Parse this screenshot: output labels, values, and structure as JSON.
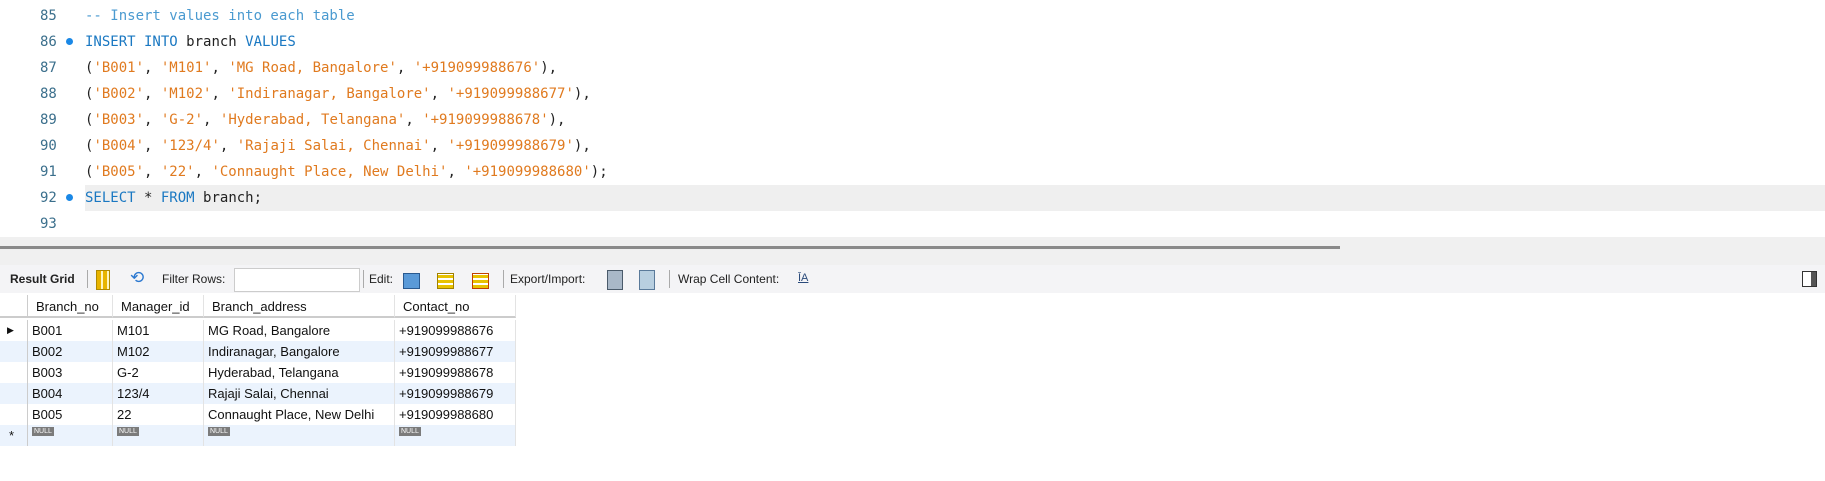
{
  "editor": {
    "lines": [
      {
        "num": "85",
        "marker": false,
        "tokens": [
          {
            "t": "cm",
            "v": "-- Insert values into each table"
          }
        ]
      },
      {
        "num": "86",
        "marker": true,
        "tokens": [
          {
            "t": "kw",
            "v": "INSERT INTO "
          },
          {
            "t": "id",
            "v": "branch "
          },
          {
            "t": "kw",
            "v": "VALUES"
          }
        ]
      },
      {
        "num": "87",
        "marker": false,
        "tokens": [
          {
            "t": "id",
            "v": "("
          },
          {
            "t": "str",
            "v": "'B001'"
          },
          {
            "t": "id",
            "v": ", "
          },
          {
            "t": "str",
            "v": "'M101'"
          },
          {
            "t": "id",
            "v": ", "
          },
          {
            "t": "str",
            "v": "'MG Road, Bangalore'"
          },
          {
            "t": "id",
            "v": ", "
          },
          {
            "t": "str",
            "v": "'+919099988676'"
          },
          {
            "t": "id",
            "v": "),"
          }
        ]
      },
      {
        "num": "88",
        "marker": false,
        "tokens": [
          {
            "t": "id",
            "v": "("
          },
          {
            "t": "str",
            "v": "'B002'"
          },
          {
            "t": "id",
            "v": ", "
          },
          {
            "t": "str",
            "v": "'M102'"
          },
          {
            "t": "id",
            "v": ", "
          },
          {
            "t": "str",
            "v": "'Indiranagar, Bangalore'"
          },
          {
            "t": "id",
            "v": ", "
          },
          {
            "t": "str",
            "v": "'+919099988677'"
          },
          {
            "t": "id",
            "v": "),"
          }
        ]
      },
      {
        "num": "89",
        "marker": false,
        "tokens": [
          {
            "t": "id",
            "v": "("
          },
          {
            "t": "str",
            "v": "'B003'"
          },
          {
            "t": "id",
            "v": ", "
          },
          {
            "t": "str",
            "v": "'G-2'"
          },
          {
            "t": "id",
            "v": ", "
          },
          {
            "t": "str",
            "v": "'Hyderabad, Telangana'"
          },
          {
            "t": "id",
            "v": ", "
          },
          {
            "t": "str",
            "v": "'+919099988678'"
          },
          {
            "t": "id",
            "v": "),"
          }
        ]
      },
      {
        "num": "90",
        "marker": false,
        "tokens": [
          {
            "t": "id",
            "v": "("
          },
          {
            "t": "str",
            "v": "'B004'"
          },
          {
            "t": "id",
            "v": ", "
          },
          {
            "t": "str",
            "v": "'123/4'"
          },
          {
            "t": "id",
            "v": ", "
          },
          {
            "t": "str",
            "v": "'Rajaji Salai, Chennai'"
          },
          {
            "t": "id",
            "v": ", "
          },
          {
            "t": "str",
            "v": "'+919099988679'"
          },
          {
            "t": "id",
            "v": "),"
          }
        ]
      },
      {
        "num": "91",
        "marker": false,
        "tokens": [
          {
            "t": "id",
            "v": "("
          },
          {
            "t": "str",
            "v": "'B005'"
          },
          {
            "t": "id",
            "v": ", "
          },
          {
            "t": "str",
            "v": "'22'"
          },
          {
            "t": "id",
            "v": ", "
          },
          {
            "t": "str",
            "v": "'Connaught Place, New Delhi'"
          },
          {
            "t": "id",
            "v": ", "
          },
          {
            "t": "str",
            "v": "'+919099988680'"
          },
          {
            "t": "id",
            "v": ");"
          }
        ]
      },
      {
        "num": "92",
        "marker": true,
        "current": true,
        "tokens": [
          {
            "t": "kw",
            "v": "SELECT "
          },
          {
            "t": "id",
            "v": "* "
          },
          {
            "t": "kw",
            "v": "FROM "
          },
          {
            "t": "id",
            "v": "branch;"
          }
        ]
      },
      {
        "num": "93",
        "marker": false,
        "tokens": []
      }
    ]
  },
  "toolbar": {
    "result_grid": "Result Grid",
    "filter_rows": "Filter Rows:",
    "filter_value": "",
    "edit": "Edit:",
    "export_import": "Export/Import:",
    "wrap": "Wrap Cell Content:"
  },
  "grid": {
    "columns": [
      "Branch_no",
      "Manager_id",
      "Branch_address",
      "Contact_no"
    ],
    "rows": [
      [
        "B001",
        "M101",
        "MG Road, Bangalore",
        "+919099988676"
      ],
      [
        "B002",
        "M102",
        "Indiranagar, Bangalore",
        "+919099988677"
      ],
      [
        "B003",
        "G-2",
        "Hyderabad, Telangana",
        "+919099988678"
      ],
      [
        "B004",
        "123/4",
        "Rajaji Salai, Chennai",
        "+919099988679"
      ],
      [
        "B005",
        "22",
        "Connaught Place, New Delhi",
        "+919099988680"
      ]
    ],
    "null_label": "NULL"
  }
}
